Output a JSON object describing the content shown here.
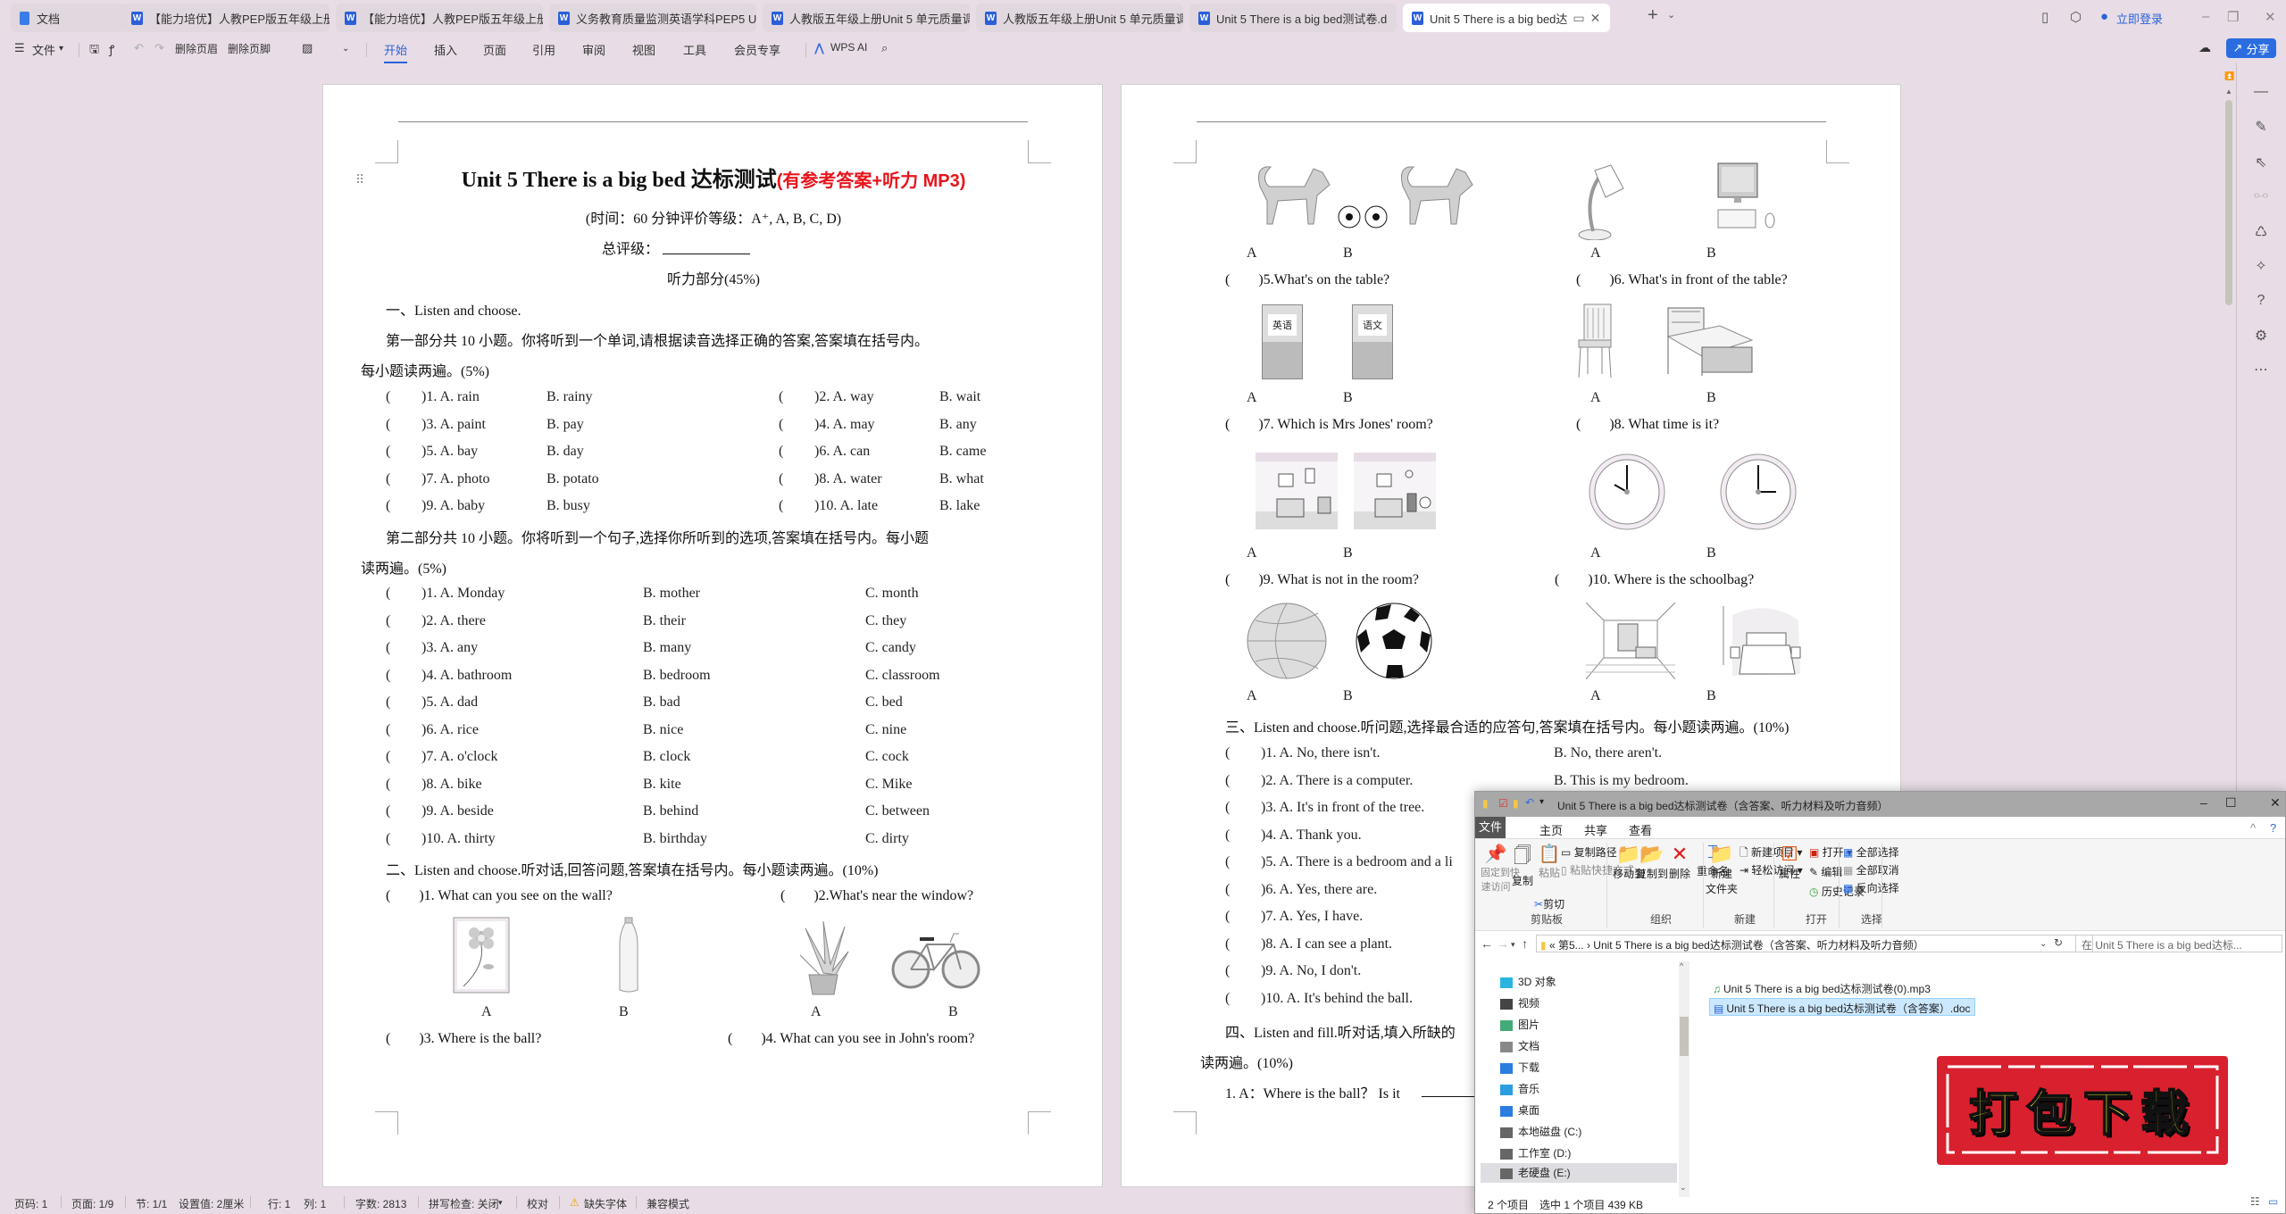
{
  "tabs": [
    {
      "label": "文档",
      "icon": "docs-icon"
    },
    {
      "label": "【能力培优】人教PEP版五年级上册英",
      "icon": "word-icon"
    },
    {
      "label": "【能力培优】人教PEP版五年级上册英",
      "icon": "word-icon"
    },
    {
      "label": "义务教育质量监测英语学科PEP5 U5.d",
      "icon": "word-icon"
    },
    {
      "label": "人教版五年级上册Unit 5 单元质量调",
      "icon": "word-icon"
    },
    {
      "label": "人教版五年级上册Unit 5 单元质量调研",
      "icon": "word-icon"
    },
    {
      "label": "Unit 5   There is a big bed测试卷.d",
      "icon": "word-icon"
    },
    {
      "label": "Unit 5 There is a big bed达",
      "icon": "word-icon",
      "active": true
    }
  ],
  "titlebar": {
    "login": "立即登录",
    "new_tab": "+"
  },
  "menu": {
    "file": "文件",
    "delete_header": "删除页眉",
    "delete_footer": "删除页脚",
    "items": [
      "开始",
      "插入",
      "页面",
      "引用",
      "审阅",
      "视图",
      "工具",
      "会员专享"
    ],
    "active": "开始",
    "wps_ai": "WPS AI",
    "share": "分享"
  },
  "page1": {
    "title": "Unit 5 There is a big bed 达标测试",
    "title_red": "(有参考答案+听力 MP3)",
    "time_line": "(时间：60 分钟评价等级：A⁺, A, B, C, D)",
    "grade_label": "总评级：",
    "listening": "听力部分(45%)",
    "sec1_title": "一、Listen and choose.",
    "part1_intro_a": "第一部分共 10 小题。你将听到一个单词,请根据读音选择正确的答案,答案填在括号内。",
    "part1_intro_b": "每小题读两遍。(5%)",
    "part1": [
      {
        "n": "1",
        "a": "rain",
        "b": "rainy"
      },
      {
        "n": "2",
        "a": "way",
        "b": "wait"
      },
      {
        "n": "3",
        "a": "paint",
        "b": "pay"
      },
      {
        "n": "4",
        "a": "may",
        "b": "any"
      },
      {
        "n": "5",
        "a": "bay",
        "b": "day"
      },
      {
        "n": "6",
        "a": "can",
        "b": "came"
      },
      {
        "n": "7",
        "a": "photo",
        "b": "potato"
      },
      {
        "n": "8",
        "a": "water",
        "b": "what"
      },
      {
        "n": "9",
        "a": "baby",
        "b": "busy"
      },
      {
        "n": "10",
        "a": "late",
        "b": "lake"
      }
    ],
    "part2_intro_a": "第二部分共 10 小题。你将听到一个句子,选择你所听到的选项,答案填在括号内。每小题",
    "part2_intro_b": "读两遍。(5%)",
    "part2": [
      {
        "n": "1",
        "a": "Monday",
        "b": "mother",
        "c": "month"
      },
      {
        "n": "2",
        "a": "there",
        "b": "their",
        "c": "they"
      },
      {
        "n": "3",
        "a": "any",
        "b": "many",
        "c": "candy"
      },
      {
        "n": "4",
        "a": "bathroom",
        "b": "bedroom",
        "c": "classroom"
      },
      {
        "n": "5",
        "a": "dad",
        "b": "bad",
        "c": "bed"
      },
      {
        "n": "6",
        "a": "rice",
        "b": "nice",
        "c": "nine"
      },
      {
        "n": "7",
        "a": "o'clock",
        "b": "clock",
        "c": "cock"
      },
      {
        "n": "8",
        "a": "bike",
        "b": "kite",
        "c": "Mike"
      },
      {
        "n": "9",
        "a": "beside",
        "b": "behind",
        "c": "between"
      },
      {
        "n": "10",
        "a": "thirty",
        "b": "birthday",
        "c": "dirty"
      }
    ],
    "sec2_title": "二、Listen and choose.听对话,回答问题,答案填在括号内。每小题读两遍。(10%)",
    "q1": ")1. What can you see on the wall?",
    "q2": ")2.What's near the window?",
    "q3": ")3. Where is the ball?",
    "q4": ")4. What can you see in John's room?",
    "opt_a": "A",
    "opt_b": "B"
  },
  "page2": {
    "q5": ")5.What's on the table?",
    "q6": ")6. What's in front of the table?",
    "q7": ")7. Which is Mrs Jones' room?",
    "q8": ")8. What time is it?",
    "q9": ")9. What is not in the room?",
    "q10": ")10. Where is the schoolbag?",
    "book_a": "英语",
    "book_b": "语文",
    "sec3_title": "三、Listen and choose.听问题,选择最合适的应答句,答案填在括号内。每小题读两遍。(10%)",
    "sec3": [
      {
        "n": "1",
        "a": "No, there isn't.",
        "b": "No, there aren't."
      },
      {
        "n": "2",
        "a": "There is a computer.",
        "b": "This is my bedroom."
      },
      {
        "n": "3",
        "a": "It's in front of the tree.",
        "b": ""
      },
      {
        "n": "4",
        "a": "Thank you.",
        "b": ""
      },
      {
        "n": "5",
        "a": "There is a bedroom and a li",
        "b": ""
      },
      {
        "n": "6",
        "a": "Yes, there are.",
        "b": ""
      },
      {
        "n": "7",
        "a": "Yes, I have.",
        "b": ""
      },
      {
        "n": "8",
        "a": "I can see a plant.",
        "b": ""
      },
      {
        "n": "9",
        "a": "No, I don't.",
        "b": ""
      },
      {
        "n": "10",
        "a": "It's behind the ball.",
        "b": ""
      }
    ],
    "sec4_title": "四、Listen and fill.听对话,填入所缺的",
    "sec4_b": "读两遍。(10%)",
    "sec4_q1": "1. A：Where is the ball？ Is it",
    "opt_a": "A",
    "opt_b": "B"
  },
  "status": {
    "page_no": "页码: 1",
    "page": "页面: 1/9",
    "section": "节: 1/1",
    "setting": "设置值: 2厘米",
    "row": "行: 1",
    "col": "列: 1",
    "words": "字数: 2813",
    "spell": "拼写检查: 关闭",
    "proof": "校对",
    "missing_font": "缺失字体",
    "compat": "兼容模式"
  },
  "explorer": {
    "title": "Unit 5 There is a big bed达标测试卷（含答案、听力材料及听力音频）",
    "tabs": [
      "文件",
      "主页",
      "共享",
      "查看"
    ],
    "ribbon": {
      "pin": "固定到快\n速访问",
      "copy": "复制",
      "paste": "粘贴",
      "copy_path": "复制路径",
      "paste_shortcut": "粘贴快捷方式",
      "cut": "剪切",
      "clipboard": "剪贴板",
      "move_to": "移动到",
      "copy_to": "复制到",
      "delete": "删除",
      "rename": "重命名",
      "organize": "组织",
      "new_folder": "新建\n文件夹",
      "new_item": "新建项目",
      "easy_access": "轻松访问",
      "new": "新建",
      "properties": "属性",
      "open": "打开",
      "edit": "编辑",
      "history": "历史记录",
      "open_group": "打开",
      "select_all": "全部选择",
      "select_none": "全部取消",
      "invert": "反向选择",
      "select": "选择"
    },
    "address": "«  第5...  ›  Unit 5 There is a big bed达标测试卷（含答案、听力材料及听力音频）",
    "search_placeholder": "在 Unit 5 There is a big bed达标...",
    "nav": [
      "3D 对象",
      "视频",
      "图片",
      "文档",
      "下载",
      "音乐",
      "桌面",
      "本地磁盘 (C:)",
      "工作室 (D:)",
      "老硬盘 (E:)"
    ],
    "files": [
      {
        "name": "Unit 5 There is a big bed达标测试卷(0).mp3",
        "selected": false
      },
      {
        "name": "Unit 5 There is a big bed达标测试卷（含答案）.doc",
        "selected": true
      }
    ],
    "count": "2 个项目",
    "selected": "选中 1 个项目  439 KB"
  },
  "badge": {
    "text": "打包下载",
    "bg": "#d9202e",
    "fg": "#ffff33"
  }
}
